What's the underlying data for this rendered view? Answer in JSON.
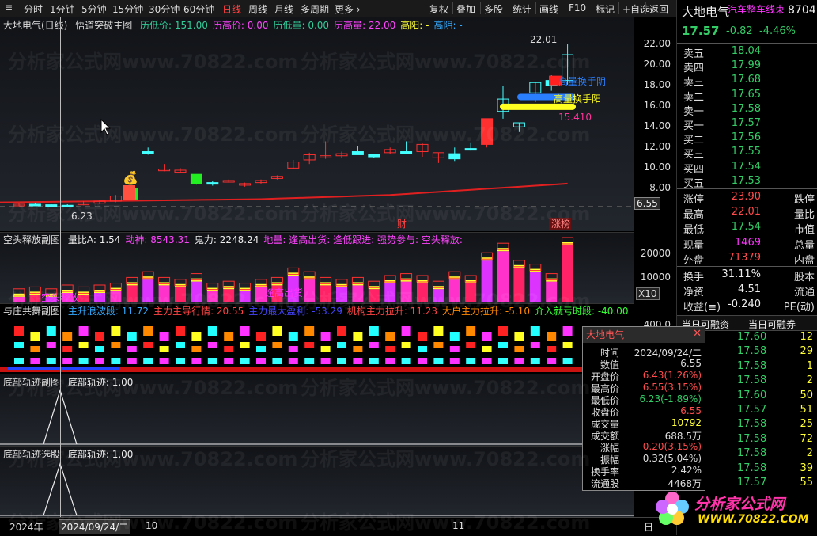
{
  "toolbar": {
    "periods": [
      "分时",
      "1分钟",
      "5分钟",
      "15分钟",
      "30分钟",
      "60分钟",
      "日线",
      "周线",
      "月线",
      "多周期",
      "更多 ›"
    ],
    "active_period": "日线",
    "actions": [
      "复权",
      "叠加",
      "多股",
      "统计",
      "画线",
      "F10",
      "标记",
      "+自选",
      "返回"
    ]
  },
  "main_chart": {
    "title": "大地电气(日线)",
    "indicator": "悟道突破主图",
    "params": [
      {
        "label": "历低价: 151.00",
        "color": "#33cc99"
      },
      {
        "label": "历高价: 0.00",
        "color": "#ff44ff"
      },
      {
        "label": "历低量: 0.00",
        "color": "#33cc99"
      },
      {
        "label": "历高量: 22.00",
        "color": "#ff44ff"
      },
      {
        "label": "高阳: -",
        "color": "#ffff33"
      },
      {
        "label": "高阴: -",
        "color": "#33aaff"
      }
    ],
    "annotations": {
      "high_label": "22.01",
      "low_label": "6.23",
      "ann_1": "高量换手阴",
      "ann_2": "高量换手阳",
      "ann_3": "15.410",
      "marker_cai": "财",
      "marker_zhang": "涨",
      "marker_bang": "榜"
    },
    "y_ticks": [
      "22.00",
      "20.00",
      "18.00",
      "16.00",
      "14.00",
      "12.00",
      "10.00",
      "8.00"
    ],
    "current_price_tag": "6.55"
  },
  "chart_data": {
    "type": "candlestick",
    "ylim": [
      5.5,
      23
    ],
    "candles": [
      [
        6.5,
        6.6,
        6.3,
        6.5
      ],
      [
        6.5,
        6.6,
        6.4,
        6.45
      ],
      [
        6.45,
        6.5,
        6.3,
        6.4
      ],
      [
        6.4,
        6.5,
        6.23,
        6.35
      ],
      [
        6.5,
        6.8,
        6.4,
        6.6
      ],
      [
        6.6,
        6.9,
        6.5,
        6.8
      ],
      [
        6.8,
        7.4,
        6.7,
        7.3
      ],
      [
        7.0,
        8.0,
        6.9,
        8.0
      ],
      [
        11.6,
        12.0,
        11.3,
        11.4
      ],
      [
        9.8,
        10.4,
        9.7,
        9.9
      ],
      [
        9.6,
        10.0,
        9.5,
        9.8
      ],
      [
        8.5,
        9.3,
        8.4,
        9.4
      ],
      [
        8.6,
        8.8,
        8.3,
        8.5
      ],
      [
        8.7,
        8.9,
        8.6,
        8.8
      ],
      [
        8.4,
        8.6,
        8.2,
        8.5
      ],
      [
        8.6,
        8.9,
        8.5,
        8.8
      ],
      [
        9.0,
        9.3,
        8.9,
        9.2
      ],
      [
        10.0,
        10.8,
        9.9,
        10.6
      ],
      [
        10.8,
        11.5,
        10.4,
        11.3
      ],
      [
        11.0,
        12.6,
        10.9,
        11.2
      ],
      [
        11.2,
        11.6,
        11.0,
        11.4
      ],
      [
        11.6,
        12.1,
        11.5,
        11.3
      ],
      [
        11.3,
        11.4,
        11.0,
        11.1
      ],
      [
        11.5,
        12.0,
        11.4,
        11.8
      ],
      [
        11.6,
        12.6,
        11.5,
        11.5
      ],
      [
        11.6,
        12.4,
        11.1,
        12.3
      ],
      [
        11.0,
        11.5,
        10.5,
        11.5
      ],
      [
        11.4,
        12.0,
        10.7,
        10.9
      ],
      [
        11.9,
        12.5,
        11.7,
        11.8
      ],
      [
        12.3,
        13.3,
        12.0,
        14.8
      ],
      [
        15.5,
        18.0,
        14.8,
        16.7
      ],
      [
        14.0,
        14.4,
        13.5,
        14.4
      ],
      [
        17.3,
        18.3,
        16.4,
        18.3
      ],
      [
        18.5,
        19.0,
        17.5,
        18.0
      ],
      [
        18.5,
        22.0,
        18.1,
        21.0
      ]
    ],
    "ma_line": [
      6.7,
      6.72,
      6.74,
      6.76,
      6.78,
      6.8,
      6.82,
      6.84,
      6.86,
      6.88,
      6.9,
      6.92,
      6.94,
      6.96,
      6.98,
      7.0,
      7.05,
      7.1,
      7.15,
      7.2,
      7.25,
      7.3,
      7.35,
      7.4,
      7.5,
      7.6,
      7.7,
      7.8,
      7.9,
      8.0,
      8.1,
      8.2,
      8.3,
      8.4,
      8.5
    ],
    "volume_ticks": [
      "20000",
      "10000"
    ],
    "volume_unit": "X10"
  },
  "sub_volume": {
    "title": "空头释放副图",
    "params": [
      {
        "label": "量比A: 1.54",
        "color": "#eeeeee"
      },
      {
        "label": "动神: 8543.31",
        "color": "#ff44ff"
      },
      {
        "label": "鬼力: 2248.24",
        "color": "#eeeeee"
      },
      {
        "label": "地量: 逢高出货: 逢低跟进: 强势参与: 空头释放:",
        "color": "#ff44ff"
      }
    ],
    "labels": [
      "空头释放",
      "逢高出货"
    ]
  },
  "sub_dance": {
    "title": "与庄共舞副图",
    "params": [
      {
        "label": "主升浪波段: 11.72",
        "color": "#33aaff"
      },
      {
        "label": "主力主导行情: 20.55",
        "color": "#ff4444"
      },
      {
        "label": "主力最大盈利: -53.29",
        "color": "#4444ff"
      },
      {
        "label": "机构主力拉升: 11.23",
        "color": "#ff4444"
      },
      {
        "label": "大户主力拉升: -5.10",
        "color": "#ff8800"
      },
      {
        "label": "介入就亏时段: -40.00",
        "color": "#33ff33"
      }
    ],
    "y_tick": "400.0"
  },
  "sub_bottom1": {
    "title": "底部轨迹副图",
    "value": "底部轨迹: 1.00"
  },
  "sub_bottom2": {
    "title": "底部轨迹选股",
    "value": "底部轨迹: 1.00"
  },
  "xaxis": {
    "labels": [
      "2024年",
      "2024/09/24/二",
      "10",
      "11"
    ],
    "corner": "日"
  },
  "quote": {
    "name": "大地电气",
    "sector": "汽车整车线束",
    "code": "8704",
    "price": "17.57",
    "change": "-0.82",
    "change_pct": "-4.46%",
    "asks": [
      {
        "label": "卖五",
        "price": "18.04"
      },
      {
        "label": "卖四",
        "price": "17.99"
      },
      {
        "label": "卖三",
        "price": "17.68"
      },
      {
        "label": "卖二",
        "price": "17.65"
      },
      {
        "label": "卖一",
        "price": "17.58"
      }
    ],
    "bids": [
      {
        "label": "买一",
        "price": "17.57"
      },
      {
        "label": "买二",
        "price": "17.56"
      },
      {
        "label": "买三",
        "price": "17.55"
      },
      {
        "label": "买四",
        "price": "17.54"
      },
      {
        "label": "买五",
        "price": "17.53"
      }
    ],
    "stats": [
      {
        "l": "涨停",
        "v": "23.90",
        "vc": "red",
        "n": "跌停"
      },
      {
        "l": "最高",
        "v": "22.01",
        "vc": "red",
        "n": "量比"
      },
      {
        "l": "最低",
        "v": "17.54",
        "vc": "grn",
        "n": "市值"
      },
      {
        "l": "现量",
        "v": "1469",
        "vc": "mag",
        "n": "总量"
      },
      {
        "l": "外盘",
        "v": "71379",
        "vc": "red",
        "n": "内盘"
      }
    ],
    "stats2": [
      {
        "l": "换手",
        "v": "31.11%",
        "vc": "wht",
        "n": "股本"
      },
      {
        "l": "净资",
        "v": "4.51",
        "vc": "wht",
        "n": "流通"
      },
      {
        "l": "收益(≡)",
        "v": "-0.240",
        "vc": "wht",
        "n": "PE(动)"
      }
    ],
    "tabs": [
      "当日可融资",
      "当日可融券"
    ],
    "trades": [
      {
        "p": "17.60",
        "q": "12"
      },
      {
        "p": "17.58",
        "q": "29"
      },
      {
        "p": "17.58",
        "q": "1"
      },
      {
        "p": "17.58",
        "q": "2"
      },
      {
        "p": "17.60",
        "q": "50"
      },
      {
        "p": "17.57",
        "q": "51"
      },
      {
        "p": "17.58",
        "q": "25"
      },
      {
        "p": "17.58",
        "q": "72"
      },
      {
        "p": "17.58",
        "q": "2"
      },
      {
        "p": "17.58",
        "q": "39"
      },
      {
        "p": "17.57",
        "q": "55"
      }
    ]
  },
  "tooltip": {
    "title": "大地电气",
    "rows": [
      {
        "k": "时间",
        "v": "2024/09/24/二",
        "c": "#dddddd"
      },
      {
        "k": "数值",
        "v": "6.55",
        "c": "#dddddd"
      },
      {
        "k": "开盘价",
        "v": "6.43(1.26%)",
        "c": "#ff4b4b"
      },
      {
        "k": "最高价",
        "v": "6.55(3.15%)",
        "c": "#ff4b4b"
      },
      {
        "k": "最低价",
        "v": "6.23(-1.89%)",
        "c": "#33cc66"
      },
      {
        "k": "收盘价",
        "v": "6.55",
        "c": "#ff4b4b"
      },
      {
        "k": "成交量",
        "v": "10792",
        "c": "#ffff33"
      },
      {
        "k": "成交额",
        "v": "688.5万",
        "c": "#dddddd"
      },
      {
        "k": "涨幅",
        "v": "0.20(3.15%)",
        "c": "#ff4b4b"
      },
      {
        "k": "振幅",
        "v": "0.32(5.04%)",
        "c": "#dddddd"
      },
      {
        "k": "换手率",
        "v": "2.42%",
        "c": "#dddddd"
      },
      {
        "k": "流通股",
        "v": "4468万",
        "c": "#dddddd"
      }
    ]
  },
  "watermark": "分析家公式网www.70822.com",
  "logo": {
    "line1": "分析家公式网",
    "line2": "WWW.70822.COM"
  }
}
